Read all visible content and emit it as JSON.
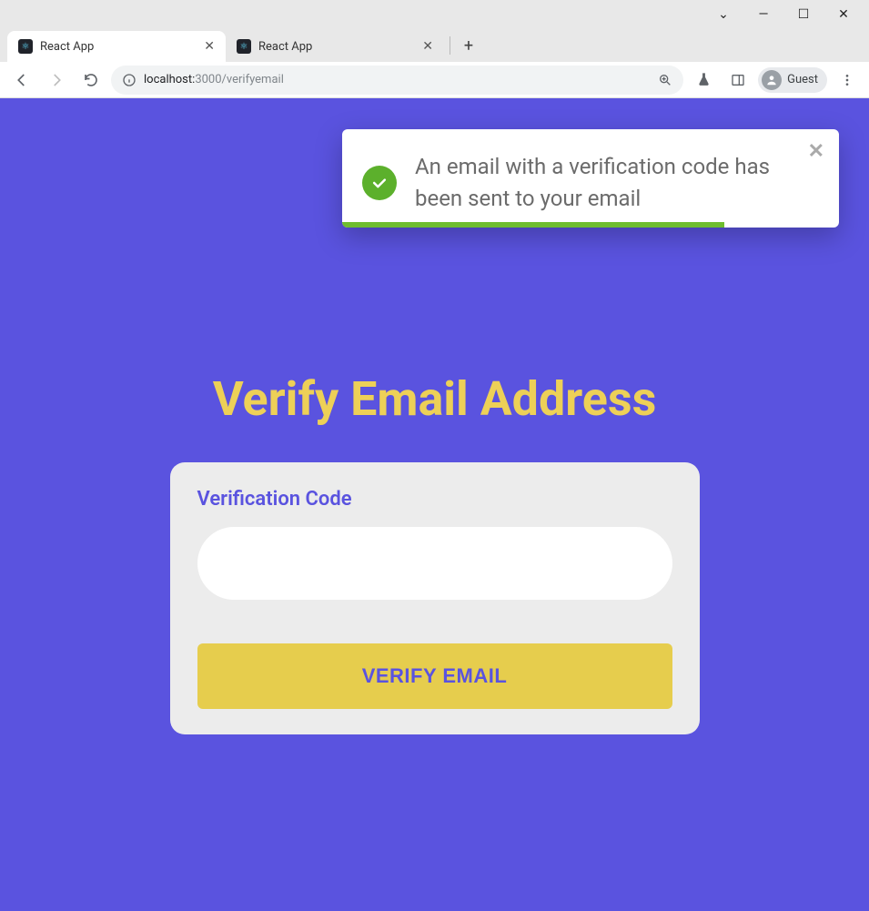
{
  "window": {
    "tabs": [
      {
        "title": "React App",
        "active": true
      },
      {
        "title": "React App",
        "active": false
      }
    ],
    "controls": {
      "dropdown": "⌄",
      "minimize": "—",
      "maximize": "☐",
      "close": "✕"
    }
  },
  "toolbar": {
    "url_host": "localhost:",
    "url_port_path": "3000/verifyemail",
    "guest_label": "Guest"
  },
  "toast": {
    "message": "An email with a verification code has been sent to your email"
  },
  "page": {
    "heading": "Verify Email Address",
    "field_label": "Verification Code",
    "input_value": "",
    "submit_label": "VERIFY EMAIL"
  }
}
